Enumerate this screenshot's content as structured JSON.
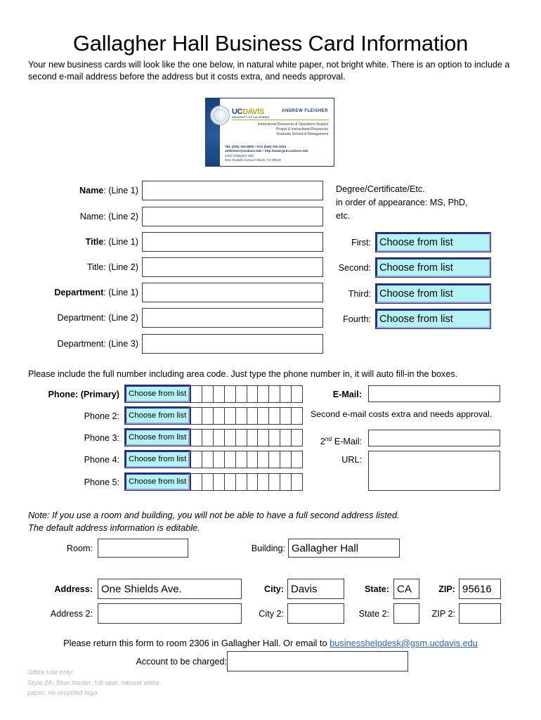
{
  "page": {
    "title": "Gallagher Hall Business Card Information",
    "intro": "Your new business cards will look like the one below, in natural white paper, not bright white. There is an option to include a second e-mail address before the address but it costs extra, and needs approval."
  },
  "card_preview": {
    "logo_uc": "UC",
    "logo_davis": "DAVIS",
    "logo_sub": "UNIVERSITY OF CALIFORNIA",
    "person_name": "ANDREW FLEISHER",
    "title_lines": [
      "Instructional Resources & Operations Analyst",
      "Project & Instructional Resources",
      "Graduate School of Management"
    ],
    "contact_lines": [
      "TEL (530) 754-8830 • FAX (530) 752-2024",
      "aefleisher@ucdavis.edu • http://www.gsm.ucdavis.edu",
      "2402 Gallagher Hall",
      "One Shields Avenue • Davis, CA 95616"
    ]
  },
  "name_section": {
    "rows": [
      {
        "bold": "Name",
        "rest": ": (Line 1)",
        "value": ""
      },
      {
        "bold": "",
        "rest": "Name: (Line 2)",
        "value": ""
      },
      {
        "bold": "Title",
        "rest": ": (Line 1)",
        "value": ""
      },
      {
        "bold": "",
        "rest": "Title: (Line 2)",
        "value": ""
      },
      {
        "bold": "Department",
        "rest": ": (Line 1)",
        "value": ""
      },
      {
        "bold": "",
        "rest": "Department: (Line 2)",
        "value": ""
      },
      {
        "bold": "",
        "rest": "Department: (Line 3)",
        "value": ""
      }
    ]
  },
  "degree_section": {
    "note": "Degree/Certificate/Etc. in order of appearance: MS, PhD, etc.",
    "note_line1": "Degree/Certificate/Etc.",
    "note_line2": "in order of appearance: MS, PhD,",
    "note_line3": "etc.",
    "dropdown_placeholder": "Choose from list",
    "rows": [
      {
        "label": "First:",
        "value": "Choose from list"
      },
      {
        "label": "Second:",
        "value": "Choose from list"
      },
      {
        "label": "Third:",
        "value": "Choose from list"
      },
      {
        "label": "Fourth:",
        "value": "Choose from list"
      }
    ]
  },
  "phone_section": {
    "instruction": "Please include the full number including area code. Just type the phone number in, it will auto fill-in the boxes.",
    "digit_count": 10,
    "rows": [
      {
        "bold": "Phone: (Primary)",
        "rest": "",
        "dropdown": "Choose from list"
      },
      {
        "bold": "",
        "rest": "Phone 2:",
        "dropdown": "Choose from list"
      },
      {
        "bold": "",
        "rest": "Phone 3:",
        "dropdown": "Choose from list"
      },
      {
        "bold": "",
        "rest": "Phone 4:",
        "dropdown": "Choose from list"
      },
      {
        "bold": "",
        "rest": "Phone 5:",
        "dropdown": "Choose from list"
      }
    ]
  },
  "email_section": {
    "email_label": "E-Mail:",
    "email_value": "",
    "second_email_note": "Second e-mail costs extra and needs approval.",
    "second_email_label_prefix": "2",
    "second_email_label_sup": "nd",
    "second_email_label_suffix": " E-Mail:",
    "second_email_value": "",
    "url_label": "URL:",
    "url_value": ""
  },
  "address_section": {
    "note_line1": "Note: If you use a room and building, you will not be able to have a full second address listed.",
    "note_line2": "The default address information is editable.",
    "room_label": "Room:",
    "room_value": "",
    "building_label": "Building:",
    "building_value": "Gallagher Hall",
    "address_label": "Address:",
    "address_value": "One Shields Ave.",
    "address2_label": "Address 2:",
    "address2_value": "",
    "city_label": "City:",
    "city_value": "Davis",
    "city2_label": "City 2:",
    "city2_value": "",
    "state_label": "State:",
    "state_value": "CA",
    "state2_label": "State 2:",
    "state2_value": "",
    "zip_label": "ZIP:",
    "zip_value": "95616",
    "zip2_label": "ZIP 2:",
    "zip2_value": ""
  },
  "footer": {
    "return_text_before": "Please return this form to room 2306 in Gallagher Hall. Or email to ",
    "return_email": "businesshelpdesk@gsm.ucdavis.edu",
    "account_label": "Account to be charged:",
    "account_value": "",
    "office_line1": "Office use only:",
    "office_line2": "Style 2A: Blue border, full seal, natural white",
    "office_line3": "paper, no recycled logo"
  },
  "colors": {
    "dropdown_fill": "#b3f3f5",
    "dropdown_border": "#2a2a8c",
    "link": "#2b62c4",
    "card_blue": "#17427c",
    "card_gold": "#d4a017",
    "office_gray": "#b9b9b9"
  }
}
